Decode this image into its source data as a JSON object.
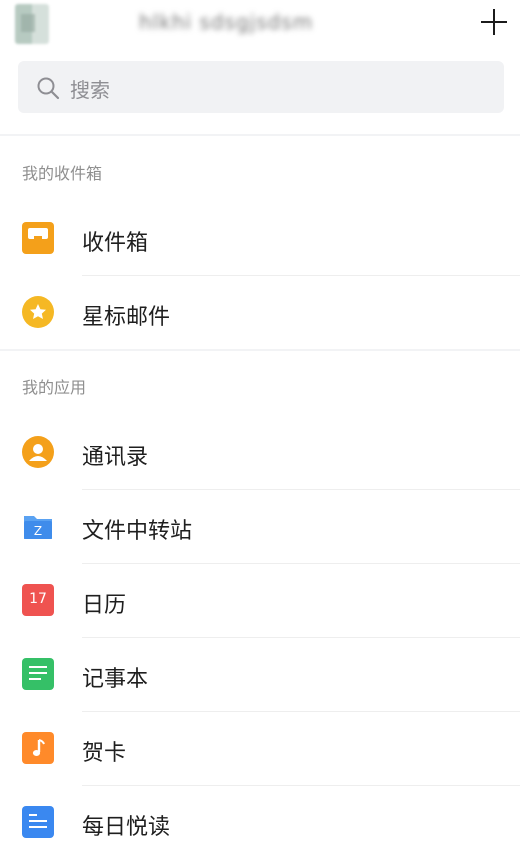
{
  "header": {
    "account_name": "hlkhi sdsgjsdsm",
    "add_icon": "plus-icon"
  },
  "search": {
    "placeholder": "搜索",
    "icon": "search-icon"
  },
  "sections": {
    "mailbox": {
      "title": "我的收件箱",
      "items": [
        {
          "label": "收件箱",
          "icon": "inbox-icon",
          "color": "#F4A01A"
        },
        {
          "label": "星标邮件",
          "icon": "star-icon",
          "color": "#F5B824"
        }
      ]
    },
    "apps": {
      "title": "我的应用",
      "items": [
        {
          "label": "通讯录",
          "icon": "contacts-icon",
          "color": "#F4A01A"
        },
        {
          "label": "文件中转站",
          "icon": "folder-icon",
          "color": "#3F8CEB"
        },
        {
          "label": "日历",
          "icon": "calendar-icon",
          "color": "#EF5350",
          "badge": "17"
        },
        {
          "label": "记事本",
          "icon": "notepad-icon",
          "color": "#35C067"
        },
        {
          "label": "贺卡",
          "icon": "greeting-card-icon",
          "color": "#FF8A2A"
        },
        {
          "label": "每日悦读",
          "icon": "daily-reading-icon",
          "color": "#3A88F0"
        }
      ]
    }
  }
}
